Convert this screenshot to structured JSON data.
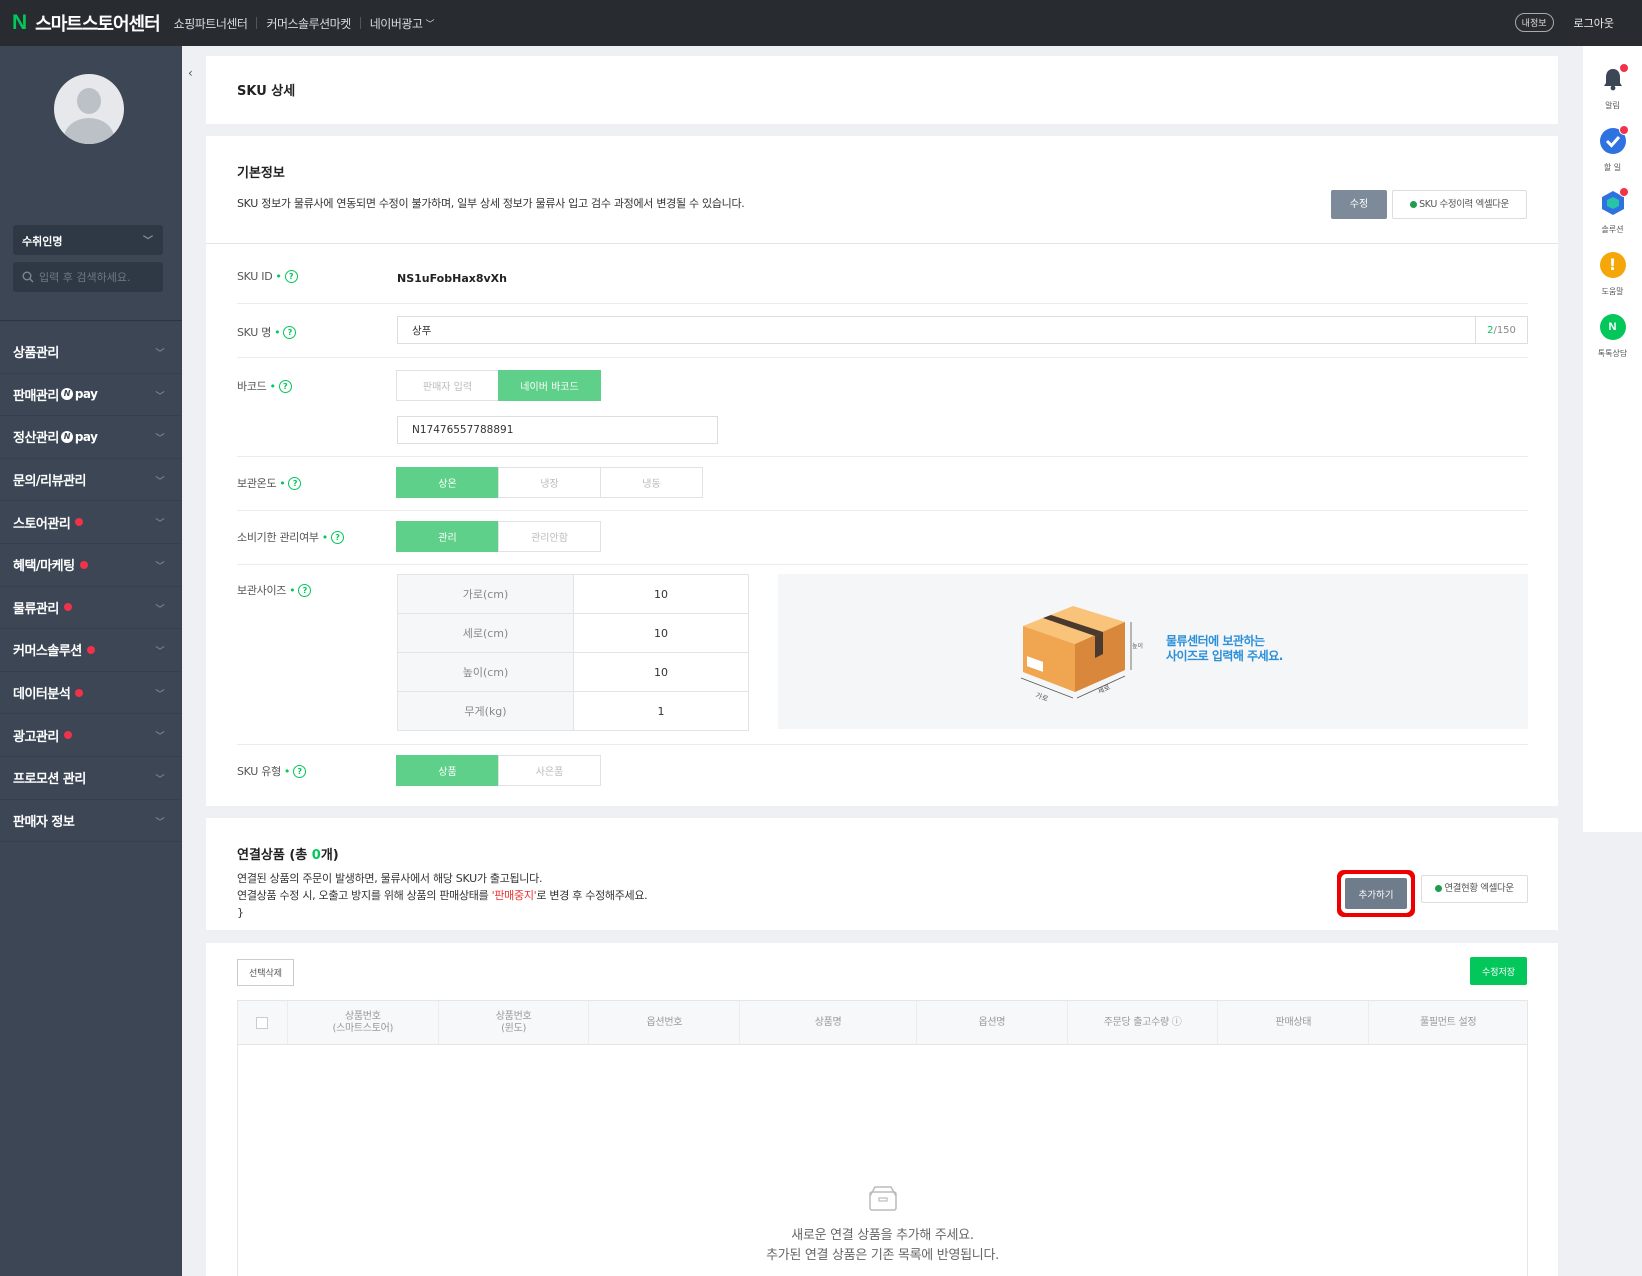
{
  "topbar": {
    "logo_n": "N",
    "logo_text": "스마트스토어센터",
    "nav": [
      "쇼핑파트너센터",
      "커머스솔루션마켓",
      "네이버광고"
    ],
    "my_info": "내정보",
    "logout": "로그아웃"
  },
  "sidebar": {
    "store_select": "수취인명",
    "search_placeholder": "입력 후 검색하세요.",
    "items": [
      {
        "label": "상품관리"
      },
      {
        "label": "판매관리",
        "pay": "pay"
      },
      {
        "label": "정산관리",
        "pay": "pay"
      },
      {
        "label": "문의/리뷰관리"
      },
      {
        "label": "스토어관리"
      },
      {
        "label": "혜택/마케팅"
      },
      {
        "label": "물류관리"
      },
      {
        "label": "커머스솔루션"
      },
      {
        "label": "데이터분석"
      },
      {
        "label": "광고관리"
      },
      {
        "label": "프로모션 관리"
      },
      {
        "label": "판매자 정보"
      }
    ]
  },
  "page_title": "SKU 상세",
  "basic": {
    "title": "기본정보",
    "desc": "SKU 정보가 물류사에 연동되면 수정이 불가하며, 일부 상세 정보가 물류사 입고 검수 과정에서 변경될 수 있습니다.",
    "edit_button": "수정",
    "history_button": "SKU 수정이력 엑셀다운",
    "sku_id_label": "SKU ID",
    "sku_id_value": "NS1uFobHax8vXh",
    "sku_name_label": "SKU 명",
    "sku_name_value": "상푸",
    "sku_name_count": "2",
    "sku_name_max": "/150",
    "barcode_label": "바코드",
    "barcode_options": [
      "판매자 입력",
      "네이버 바코드"
    ],
    "barcode_value": "N17476557788891",
    "temp_label": "보관온도",
    "temp_options": [
      "상온",
      "냉장",
      "냉동"
    ],
    "expiry_label": "소비기한 관리여부",
    "expiry_options": [
      "관리",
      "관리안함"
    ],
    "size_label": "보관사이즈",
    "size_rows": [
      {
        "name": "가로(cm)",
        "value": "10"
      },
      {
        "name": "세로(cm)",
        "value": "10"
      },
      {
        "name": "높이(cm)",
        "value": "10"
      },
      {
        "name": "무게(kg)",
        "value": "1"
      }
    ],
    "box_text_1": "물류센터에 보관하는",
    "box_text_2": "사이즈로 입력해 주세요.",
    "box_dim_w": "가로",
    "box_dim_d": "세로",
    "box_dim_h": "높이",
    "type_label": "SKU 유형",
    "type_options": [
      "상품",
      "사은품"
    ]
  },
  "linked": {
    "title_prefix": "연결상품 (총 ",
    "count": "0",
    "title_suffix": "개)",
    "desc_1": "연결된 상품의 주문이 발생하면, 물류사에서 해당 SKU가 출고됩니다.",
    "desc_2a": "연결상품 수정 시, 오출고 방지를 위해 상품의 판매상태를 ",
    "desc_2b": "'판매중지'",
    "desc_2c": "로 변경 후 수정해주세요.",
    "add_button": "추가하기",
    "excel_button": "연결현황 엑셀다운"
  },
  "table": {
    "select_delete": "선택삭제",
    "save_button": "수정저장",
    "columns": [
      "상품번호\n(스마트스토어)",
      "상품번호\n(윈도)",
      "옵션번호",
      "상품명",
      "옵션명",
      "주문당 출고수량 ⓘ",
      "판매상태",
      "풀필먼트 설정"
    ],
    "empty_1": "새로운 연결 상품을 추가해 주세요.",
    "empty_2": "추가된 연결 상품은 기존 목록에 반영됩니다."
  },
  "right_rail": [
    "알림",
    "할 일",
    "솔루션",
    "도움말",
    "톡톡상담"
  ],
  "colors": {
    "green": "#03c75a",
    "sidebar": "#3c4655",
    "topbar": "#282c31",
    "highlight": "#ee0000"
  }
}
